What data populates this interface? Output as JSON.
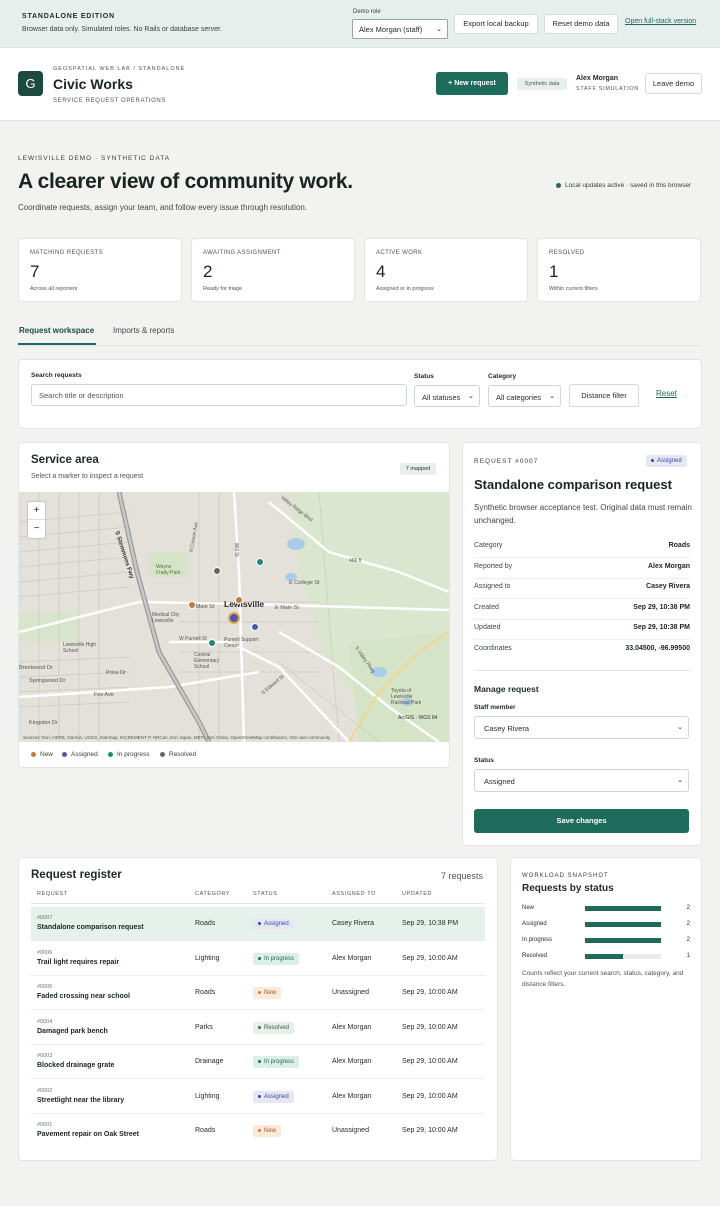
{
  "banner": {
    "edition": "STANDALONE EDITION",
    "description": "Browser data only. Simulated roles. No Rails or database server.",
    "role_label": "Demo role",
    "role_value": "Alex Morgan (staff)",
    "export_label": "Export local backup",
    "reset_label": "Reset demo data",
    "fullstack_link": "Open full-stack version"
  },
  "header": {
    "logo_letter": "G",
    "kicker": "GEOSPATIAL WEB LAB / STANDALONE",
    "title": "Civic Works",
    "subtitle": "SERVICE REQUEST OPERATIONS",
    "new_request": "+ New request",
    "synthetic_badge": "Synthetic data",
    "user_name": "Alex Morgan",
    "user_role": "STAFF SIMULATION",
    "leave_demo": "Leave demo"
  },
  "hero": {
    "kicker": "LEWISVILLE DEMO · SYNTHETIC DATA",
    "title": "A clearer view of community work.",
    "subtitle": "Coordinate requests, assign your team, and follow every issue through resolution.",
    "live_status": "Local updates active · saved in this browser"
  },
  "stats": [
    {
      "label": "MATCHING REQUESTS",
      "value": "7",
      "note": "Across all reporters"
    },
    {
      "label": "AWAITING ASSIGNMENT",
      "value": "2",
      "note": "Ready for triage"
    },
    {
      "label": "ACTIVE WORK",
      "value": "4",
      "note": "Assigned or in progress"
    },
    {
      "label": "RESOLVED",
      "value": "1",
      "note": "Within current filters"
    }
  ],
  "tabs": [
    "Request workspace",
    "Imports & reports"
  ],
  "filters": {
    "search_label": "Search requests",
    "search_placeholder": "Search title or description",
    "status_label": "Status",
    "status_value": "All statuses",
    "category_label": "Category",
    "category_value": "All categories",
    "distance_button": "Distance filter",
    "reset": "Reset"
  },
  "map": {
    "title": "Service area",
    "subtitle": "Select a marker to inspect a request",
    "mapped_badge": "7 mapped",
    "zoom_in": "+",
    "zoom_out": "−",
    "attribution": "Sources: Esri, HERE, Garmin, USGS, Intermap, INCREMENT P, NRCan, Esri Japan, METI, Esri China, OpenStreetMap contributors, GIS user community",
    "scale": "ArcGIS · WGS 84",
    "labels": {
      "lewisville": "Lewisville",
      "valley_ridge": "Valley Ridge Blvd",
      "college": "E College St",
      "main": "W Main St",
      "main_e": "E Main St",
      "purnell": "Purnell Support Center",
      "central": "Central Elementary School",
      "lewisville_high": "Lewisville High School",
      "medical": "Medical City Lewisville",
      "wayne": "Wayne Frady Park",
      "springwood": "Springwood Dr",
      "fox": "Fox Ave",
      "kingston": "Kingston Dr",
      "brentwood": "Brentwood Dr",
      "price": "Price Dr",
      "elev": "466 ft",
      "toyota": "Toyota of Lewisville Railroad Park",
      "mill": "Mill St",
      "hwy": "S Stemmons Fwy",
      "cowan": "N Cowan Ave",
      "valley_pkwy": "S Valley Pkwy",
      "purnell_short": "W Purnell St",
      "edward": "S Edward St"
    },
    "markers": [
      {
        "status": "new",
        "color": "#c7793c"
      },
      {
        "status": "new",
        "color": "#c7793c"
      },
      {
        "status": "assigned",
        "color": "#4a56b0"
      },
      {
        "status": "assigned",
        "color": "#4a56b0"
      },
      {
        "status": "in_progress",
        "color": "#1d8a74"
      },
      {
        "status": "in_progress",
        "color": "#1d8a74"
      },
      {
        "status": "resolved",
        "color": "#666666"
      }
    ]
  },
  "legend": [
    {
      "label": "New",
      "color": "#c7793c"
    },
    {
      "label": "Assigned",
      "color": "#4a56b0"
    },
    {
      "label": "In progress",
      "color": "#1d8a74"
    },
    {
      "label": "Resolved",
      "color": "#666666"
    }
  ],
  "detail": {
    "id": "REQUEST #0007",
    "status": "Assigned",
    "title": "Standalone comparison request",
    "description": "Synthetic browser acceptance test. Original data must remain unchanged.",
    "rows": [
      {
        "k": "Category",
        "v": "Roads"
      },
      {
        "k": "Reported by",
        "v": "Alex Morgan"
      },
      {
        "k": "Assigned to",
        "v": "Casey Rivera"
      },
      {
        "k": "Created",
        "v": "Sep 29, 10:38 PM"
      },
      {
        "k": "Updated",
        "v": "Sep 29, 10:38 PM"
      },
      {
        "k": "Coordinates",
        "v": "33.04500, -96.99500"
      }
    ],
    "manage_title": "Manage request",
    "staff_label": "Staff member",
    "staff_value": "Casey Rivera",
    "status_label": "Status",
    "status_value": "Assigned",
    "save": "Save changes"
  },
  "register": {
    "title": "Request register",
    "count": "7 requests",
    "headers": [
      "REQUEST",
      "CATEGORY",
      "STATUS",
      "ASSIGNED TO",
      "UPDATED"
    ],
    "rows": [
      {
        "num": "#0007",
        "name": "Standalone comparison request",
        "category": "Roads",
        "status": "Assigned",
        "assigned": "Casey Rivera",
        "updated": "Sep 29, 10:38 PM"
      },
      {
        "num": "#0006",
        "name": "Trail light requires repair",
        "category": "Lighting",
        "status": "In progress",
        "assigned": "Alex Morgan",
        "updated": "Sep 29, 10:00 AM"
      },
      {
        "num": "#0005",
        "name": "Faded crossing near school",
        "category": "Roads",
        "status": "New",
        "assigned": "Unassigned",
        "updated": "Sep 29, 10:00 AM"
      },
      {
        "num": "#0004",
        "name": "Damaged park bench",
        "category": "Parks",
        "status": "Resolved",
        "assigned": "Alex Morgan",
        "updated": "Sep 29, 10:00 AM"
      },
      {
        "num": "#0003",
        "name": "Blocked drainage grate",
        "category": "Drainage",
        "status": "In progress",
        "assigned": "Alex Morgan",
        "updated": "Sep 29, 10:00 AM"
      },
      {
        "num": "#0002",
        "name": "Streetlight near the library",
        "category": "Lighting",
        "status": "Assigned",
        "assigned": "Alex Morgan",
        "updated": "Sep 29, 10:00 AM"
      },
      {
        "num": "#0001",
        "name": "Pavement repair on Oak Street",
        "category": "Roads",
        "status": "New",
        "assigned": "Unassigned",
        "updated": "Sep 29, 10:00 AM"
      }
    ]
  },
  "workload": {
    "kicker": "WORKLOAD SNAPSHOT",
    "title": "Requests by status",
    "rows": [
      {
        "k": "New",
        "n": "2",
        "fraction": 1.0
      },
      {
        "k": "Assigned",
        "n": "2",
        "fraction": 1.0
      },
      {
        "k": "In progress",
        "n": "2",
        "fraction": 1.0
      },
      {
        "k": "Resolved",
        "n": "1",
        "fraction": 0.5
      }
    ],
    "note": "Counts reflect your current search, status, category, and distance filters."
  }
}
